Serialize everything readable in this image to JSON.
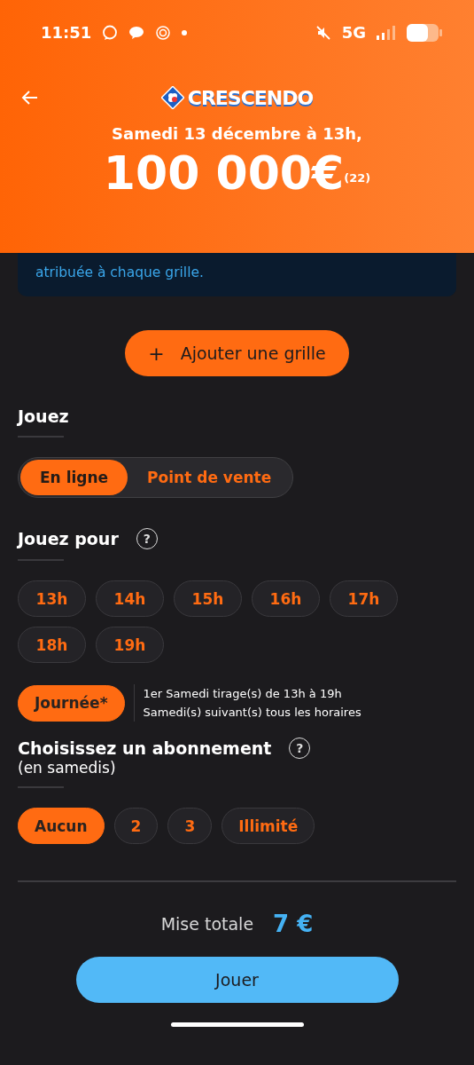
{
  "status_bar": {
    "time": "11:51",
    "network": "5G"
  },
  "header": {
    "logo": "CRESCENDO",
    "date": "Samedi 13 décembre à 13h,",
    "amount": "100 000€$^{(22)}$"
  },
  "info": [
    "atribuée à chaque grille."
  ],
  "add_button": {
    "icon": "+",
    "label": "Ajouter une grille"
  },
  "play_mode": {
    "title": "Jouez",
    "options": [
      {
        "label": "En ligne",
        "selected": true
      },
      {
        "label": "Point de vente",
        "selected": false
      }
    ]
  },
  "draw_times": {
    "title": "Jouez pour",
    "help": "?",
    "options": [
      {
        "label": "13h",
        "selected": false
      },
      {
        "label": "14h",
        "selected": false
      },
      {
        "label": "15h",
        "selected": false
      },
      {
        "label": "16h",
        "selected": false
      },
      {
        "label": "17h",
        "selected": false
      },
      {
        "label": "18h",
        "selected": false
      },
      {
        "label": "19h",
        "selected": false
      }
    ],
    "day": {
      "label": "Journée*",
      "selected": true
    },
    "day_notes": [
      "1er Samedi tirage(s) de 13h à 19h",
      "Samedi(s) suivant(s) tous les horaires"
    ]
  },
  "subscription": {
    "title": "Choisissez un abonnement",
    "subtitle": "(en samedis)",
    "help": "?",
    "options": [
      {
        "label": "Aucun",
        "selected": true
      },
      {
        "label": "2",
        "selected": false
      },
      {
        "label": "3",
        "selected": false
      },
      {
        "label": "Illimité",
        "selected": false
      }
    ]
  },
  "total": {
    "label": "Mise totale",
    "amount": "7 €"
  },
  "play_button": "Jouer"
}
